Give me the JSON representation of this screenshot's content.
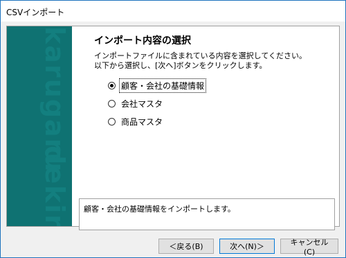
{
  "window": {
    "title": "CSVインポート"
  },
  "sidebar": {
    "brand_top": "karugaru",
    "brand_bottom": "dekiru"
  },
  "wizard": {
    "heading": "インポート内容の選択",
    "desc_line1": "インポートファイルに含まれている内容を選択してください。",
    "desc_line2": "以下から選択し、[次へ]ボタンをクリックします。",
    "options": [
      {
        "label": "顧客・会社の基礎情報",
        "selected": true
      },
      {
        "label": "会社マスタ",
        "selected": false
      },
      {
        "label": "商品マスタ",
        "selected": false
      }
    ],
    "description": "顧客・会社の基礎情報をインポートします。"
  },
  "buttons": {
    "back": "＜戻る(B)",
    "next": "次へ(N)＞",
    "cancel": "キャンセル(C)"
  }
}
